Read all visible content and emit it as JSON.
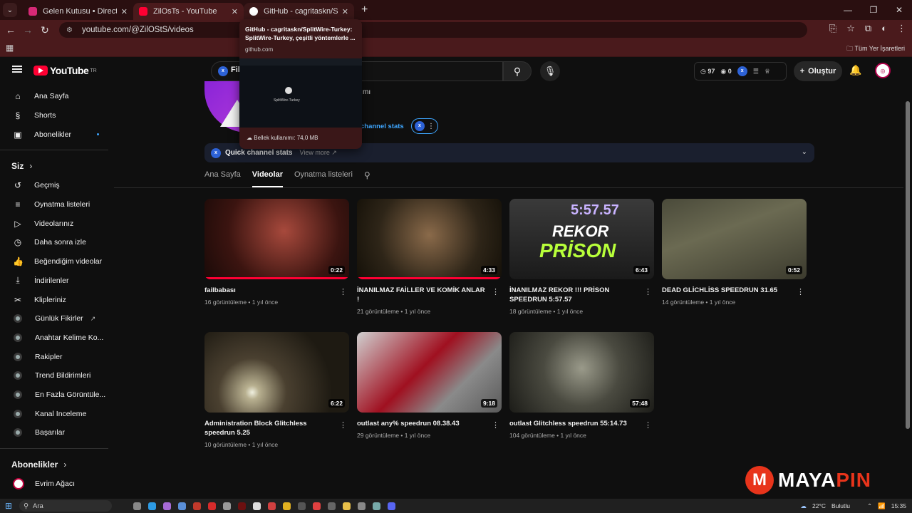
{
  "browser": {
    "tabs": [
      {
        "title": "Gelen Kutusu • Direct",
        "favicon_color": "#d62976"
      },
      {
        "title": "ZilOsTs - YouTube",
        "favicon_color": "#ff0033"
      },
      {
        "title": "GitHub - cagritaskn/SplitWire-T",
        "favicon_color": "#ffffff"
      }
    ],
    "url": "youtube.com/@ZilOStS/videos",
    "bookmarks_all": "Tüm Yer İşaretleri",
    "popup": {
      "title": "GitHub - cagritaskn/SplitWire-Turkey: SplitWire-Turkey, çeşitli yöntemlerle ...",
      "domain": "github.com",
      "preview_name": "SplitWire-Turkey",
      "memory": "Bellek kullanımı: 74,0 MB"
    }
  },
  "masthead": {
    "logo": "YouTube",
    "logo_region": "TR",
    "filter_label": "Filt",
    "ext_stat_1": "97",
    "ext_stat_2": "0",
    "create_label": "Oluştur"
  },
  "sidebar": {
    "main": [
      {
        "label": "Ana Sayfa",
        "icon": "home-icon"
      },
      {
        "label": "Shorts",
        "icon": "shorts-icon"
      },
      {
        "label": "Abonelikler",
        "icon": "subscriptions-icon"
      }
    ],
    "you_heading": "Siz",
    "you": [
      {
        "label": "Geçmiş"
      },
      {
        "label": "Oynatma listeleri"
      },
      {
        "label": "Videolarınız"
      },
      {
        "label": "Daha sonra izle"
      },
      {
        "label": "Beğendiğim videolar"
      },
      {
        "label": "İndirilenler"
      },
      {
        "label": "Klipleriniz"
      },
      {
        "label": "Günlük Fikirler"
      },
      {
        "label": "Anahtar Kelime Ko..."
      },
      {
        "label": "Rakipler"
      },
      {
        "label": "Trend Bildirimleri"
      },
      {
        "label": "En Fazla Görüntüle..."
      },
      {
        "label": "Kanal Inceleme"
      },
      {
        "label": "Başarılar"
      }
    ],
    "subs_heading": "Abonelikler",
    "subs": [
      {
        "label": "Evrim Ağacı"
      }
    ]
  },
  "channel": {
    "name_partial": "mı",
    "channel_stats_link": "channel stats",
    "quick_stats_title": "Quick channel stats",
    "view_more": "View more"
  },
  "tabs": [
    "Ana Sayfa",
    "Videolar",
    "Oynatma listeleri"
  ],
  "videos": [
    {
      "title": "failbabası",
      "meta": "16 görüntüleme • 1 yıl önce",
      "duration": "0:22",
      "progress": 1.0
    },
    {
      "title": "İNANILMAZ FAİLLER VE KOMİK ANLAR !",
      "meta": "21 görüntüleme • 1 yıl önce",
      "duration": "4:33",
      "progress": 1.0
    },
    {
      "title": "İNANILMAZ REKOR !!! PRİSON SPEEDRUN 5:57.57",
      "meta": "18 görüntüleme • 1 yıl önce",
      "duration": "6:43",
      "progress": 0.0,
      "thumb_overlay_time": "5:57.57",
      "thumb_overlay_text1": "REKOR",
      "thumb_overlay_text2": "PRİSON"
    },
    {
      "title": "DEAD GLİCHLİSS SPEEDRUN 31.65",
      "meta": "14 görüntüleme • 1 yıl önce",
      "duration": "0:52",
      "progress": 0.0
    },
    {
      "title": "Administration Block Glitchless speedrun 5.25",
      "meta": "10 görüntüleme • 1 yıl önce",
      "duration": "6:22",
      "progress": 0.0
    },
    {
      "title": "outlast any% speedrun 08.38.43",
      "meta": "29 görüntüleme • 1 yıl önce",
      "duration": "9:18",
      "progress": 0.0
    },
    {
      "title": "outlast Glitchless speedrun 55:14.73",
      "meta": "104 görüntüleme • 1 yıl önce",
      "duration": "57:48",
      "progress": 0.0
    }
  ],
  "taskbar": {
    "search": "Ara",
    "weather": "22°C",
    "weather_text": "Bulutlu",
    "time": "15:35"
  },
  "watermark": {
    "part1": "MAYA",
    "part2": "PIN",
    "logo_letter": "M"
  }
}
